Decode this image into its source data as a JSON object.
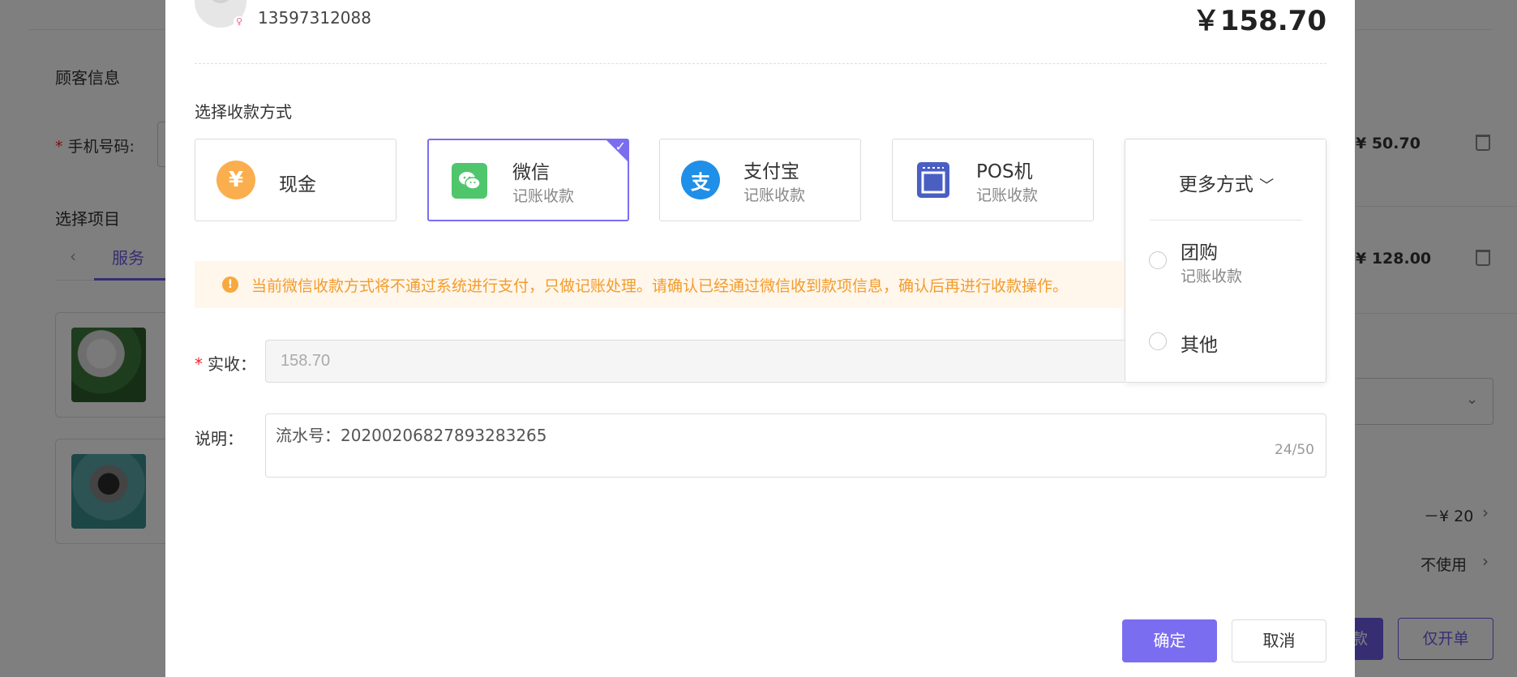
{
  "background": {
    "customer_section_title": "顾客信息",
    "phone_label": "手机号码:",
    "project_section_title": "选择项目",
    "tab_prev_icon": "chevron-left-icon",
    "tab_service": "服务",
    "item_prices": [
      "¥ 50.70",
      "¥ 128.00"
    ],
    "discount_value": "－¥ 20",
    "coupon_value": "不使用",
    "checkout_button_partial": "款",
    "open_only_button": "仅开单"
  },
  "modal": {
    "customer_phone": "13597312088",
    "total_amount": "￥158.70",
    "pay_method_title": "选择收款方式",
    "pay_methods": [
      {
        "name": "现金",
        "sub": "",
        "icon": "cash-yen-icon",
        "color": "#fbae4e",
        "glyph": "¥",
        "selected": false
      },
      {
        "name": "微信",
        "sub": "记账收款",
        "icon": "wechat-icon",
        "color": "#4fc66b",
        "glyph": "",
        "selected": true
      },
      {
        "name": "支付宝",
        "sub": "记账收款",
        "icon": "alipay-icon",
        "color": "#1f8fe8",
        "glyph": "支",
        "selected": false
      },
      {
        "name": "POS机",
        "sub": "记账收款",
        "icon": "pos-terminal-icon",
        "color": "#4b5fc3",
        "glyph": "",
        "selected": false
      }
    ],
    "more_methods": {
      "label": "更多方式",
      "options": [
        {
          "name": "团购",
          "sub": "记账收款"
        },
        {
          "name": "其他",
          "sub": ""
        }
      ]
    },
    "alert_text": "当前微信收款方式将不通过系统进行支付，只做记账处理。请确认已经通过微信收到款项信息，确认后再进行收款操作。",
    "received_label": "实收：",
    "received_value": "158.70",
    "note_label": "说明：",
    "note_value": "流水号：20200206827893283265",
    "note_count": "24/50",
    "confirm_label": "确定",
    "cancel_label": "取消"
  }
}
